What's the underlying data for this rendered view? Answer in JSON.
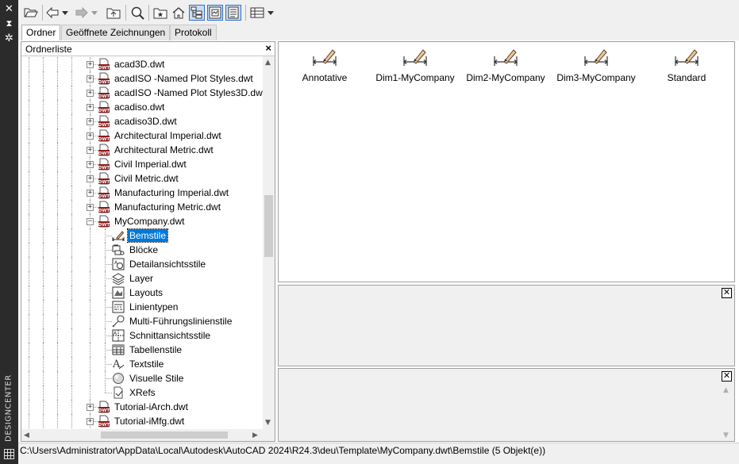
{
  "palette_title": "DESIGNCENTER",
  "tabs": [
    {
      "label": "Ordner",
      "active": true
    },
    {
      "label": "Geöffnete Zeichnungen",
      "active": false
    },
    {
      "label": "Protokoll",
      "active": false
    }
  ],
  "folder_list": {
    "title": "Ordnerliste",
    "close": "×"
  },
  "tree": {
    "files": [
      {
        "label": "acad3D.dwt"
      },
      {
        "label": "acadISO -Named Plot Styles.dwt"
      },
      {
        "label": "acadISO -Named Plot Styles3D.dwt"
      },
      {
        "label": "acadiso.dwt"
      },
      {
        "label": "acadiso3D.dwt"
      },
      {
        "label": "Architectural Imperial.dwt"
      },
      {
        "label": "Architectural Metric.dwt"
      },
      {
        "label": "Civil Imperial.dwt"
      },
      {
        "label": "Civil Metric.dwt"
      },
      {
        "label": "Manufacturing Imperial.dwt"
      },
      {
        "label": "Manufacturing Metric.dwt"
      },
      {
        "label": "MyCompany.dwt"
      }
    ],
    "children": [
      {
        "label": "Bemstile",
        "icon": "dimstyle-icon",
        "selected": true
      },
      {
        "label": "Blöcke",
        "icon": "blocks-icon"
      },
      {
        "label": "Detailansichtsstile",
        "icon": "detail-view-icon"
      },
      {
        "label": "Layer",
        "icon": "layers-icon"
      },
      {
        "label": "Layouts",
        "icon": "layouts-icon"
      },
      {
        "label": "Linientypen",
        "icon": "linetypes-icon"
      },
      {
        "label": "Multi-Führungslinienstile",
        "icon": "mleader-icon"
      },
      {
        "label": "Schnittansichtsstile",
        "icon": "section-view-icon"
      },
      {
        "label": "Tabellenstile",
        "icon": "table-styles-icon"
      },
      {
        "label": "Textstile",
        "icon": "text-styles-icon"
      },
      {
        "label": "Visuelle Stile",
        "icon": "visual-styles-icon"
      },
      {
        "label": "XRefs",
        "icon": "xrefs-icon"
      }
    ],
    "after": [
      {
        "label": "Tutorial-iArch.dwt"
      },
      {
        "label": "Tutorial-iMfg.dwt"
      }
    ]
  },
  "content_items": [
    {
      "label": "Annotative"
    },
    {
      "label": "Dim1-MyCompany"
    },
    {
      "label": "Dim2-MyCompany"
    },
    {
      "label": "Dim3-MyCompany"
    },
    {
      "label": "Standard"
    }
  ],
  "status": {
    "path": "C:\\Users\\Administrator\\AppData\\Local\\Autodesk\\AutoCAD 2024\\R24.3\\deu\\Template\\MyCompany.dwt\\Bemstile (5 Objekt(e))"
  },
  "colors": {
    "selection": "#0078d7",
    "dwt_icon": "#8b1a1a",
    "palette_bar": "#2b2b2b"
  }
}
